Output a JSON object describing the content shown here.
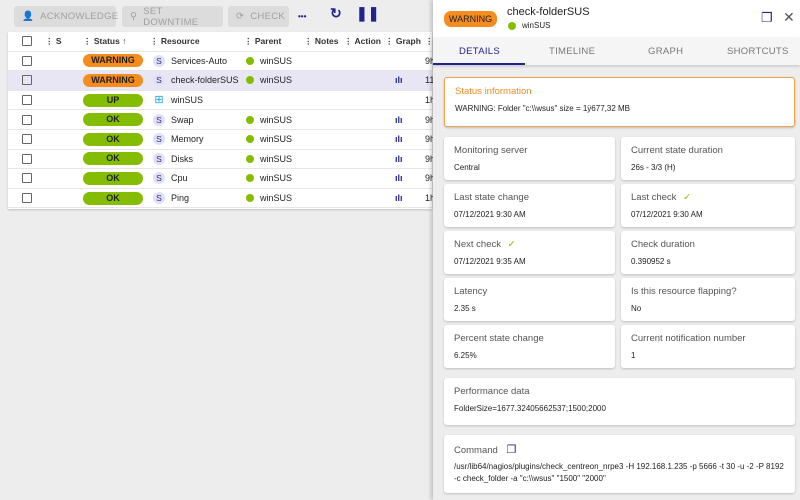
{
  "toolbar": {
    "acknowledge": "ACKNOWLEDGE",
    "set_downtime": "SET DOWNTIME",
    "check": "CHECK",
    "more": "•••"
  },
  "table": {
    "headers": [
      "S",
      "Status",
      "Resource",
      "Parent",
      "Notes",
      "Action",
      "Graph"
    ],
    "rows": [
      {
        "status": "WARNING",
        "color": "#f58c1e",
        "type": "S",
        "resource": "Services-Auto",
        "parent": "winSUS",
        "graph": false,
        "time": "9h"
      },
      {
        "status": "WARNING",
        "color": "#f58c1e",
        "type": "S",
        "resource": "check-folderSUS",
        "parent": "winSUS",
        "graph": true,
        "time": "11"
      },
      {
        "status": "UP",
        "color": "#84bd00",
        "type": "windows",
        "resource": "winSUS",
        "parent": "",
        "graph": false,
        "time": "1h"
      },
      {
        "status": "OK",
        "color": "#84bd00",
        "type": "S",
        "resource": "Swap",
        "parent": "winSUS",
        "graph": true,
        "time": "9h"
      },
      {
        "status": "OK",
        "color": "#84bd00",
        "type": "S",
        "resource": "Memory",
        "parent": "winSUS",
        "graph": true,
        "time": "9h"
      },
      {
        "status": "OK",
        "color": "#84bd00",
        "type": "S",
        "resource": "Disks",
        "parent": "winSUS",
        "graph": true,
        "time": "9h"
      },
      {
        "status": "OK",
        "color": "#84bd00",
        "type": "S",
        "resource": "Cpu",
        "parent": "winSUS",
        "graph": true,
        "time": "9h"
      },
      {
        "status": "OK",
        "color": "#84bd00",
        "type": "S",
        "resource": "Ping",
        "parent": "winSUS",
        "graph": true,
        "time": "1h"
      }
    ]
  },
  "panel": {
    "status": "WARNING",
    "title": "check-folderSUS",
    "parent": "winSUS",
    "tabs": [
      "DETAILS",
      "TIMELINE",
      "GRAPH",
      "SHORTCUTS"
    ],
    "status_info": {
      "title": "Status information",
      "text": "WARNING: Folder \"c:\\\\wsus\" size = 1ÿ677,32 MB"
    },
    "cards": [
      {
        "label": "Monitoring server",
        "value": "Central"
      },
      {
        "label": "Current state duration",
        "value": "26s - 3/3 (H)"
      },
      {
        "label": "Last state change",
        "value": "07/12/2021 9:30 AM"
      },
      {
        "label": "Last check",
        "value": "07/12/2021 9:30 AM",
        "check": true
      },
      {
        "label": "Next check",
        "value": "07/12/2021 9:35 AM",
        "check": true
      },
      {
        "label": "Check duration",
        "value": "0.390952 s"
      },
      {
        "label": "Latency",
        "value": "2.35 s"
      },
      {
        "label": "Is this resource flapping?",
        "value": "No"
      },
      {
        "label": "Percent state change",
        "value": "6.25%"
      },
      {
        "label": "Current notification number",
        "value": "1"
      }
    ],
    "performance": {
      "label": "Performance data",
      "value": "FolderSize=1677.32405662537;1500;2000"
    },
    "command": {
      "label": "Command",
      "value": "/usr/lib64/nagios/plugins/check_centreon_nrpe3 -H 192.168.1.235 -p 5666 -t 30 -u -2 -P 8192 -c check_folder -a \"c:\\\\wsus\" \"1500\" \"2000\""
    }
  }
}
